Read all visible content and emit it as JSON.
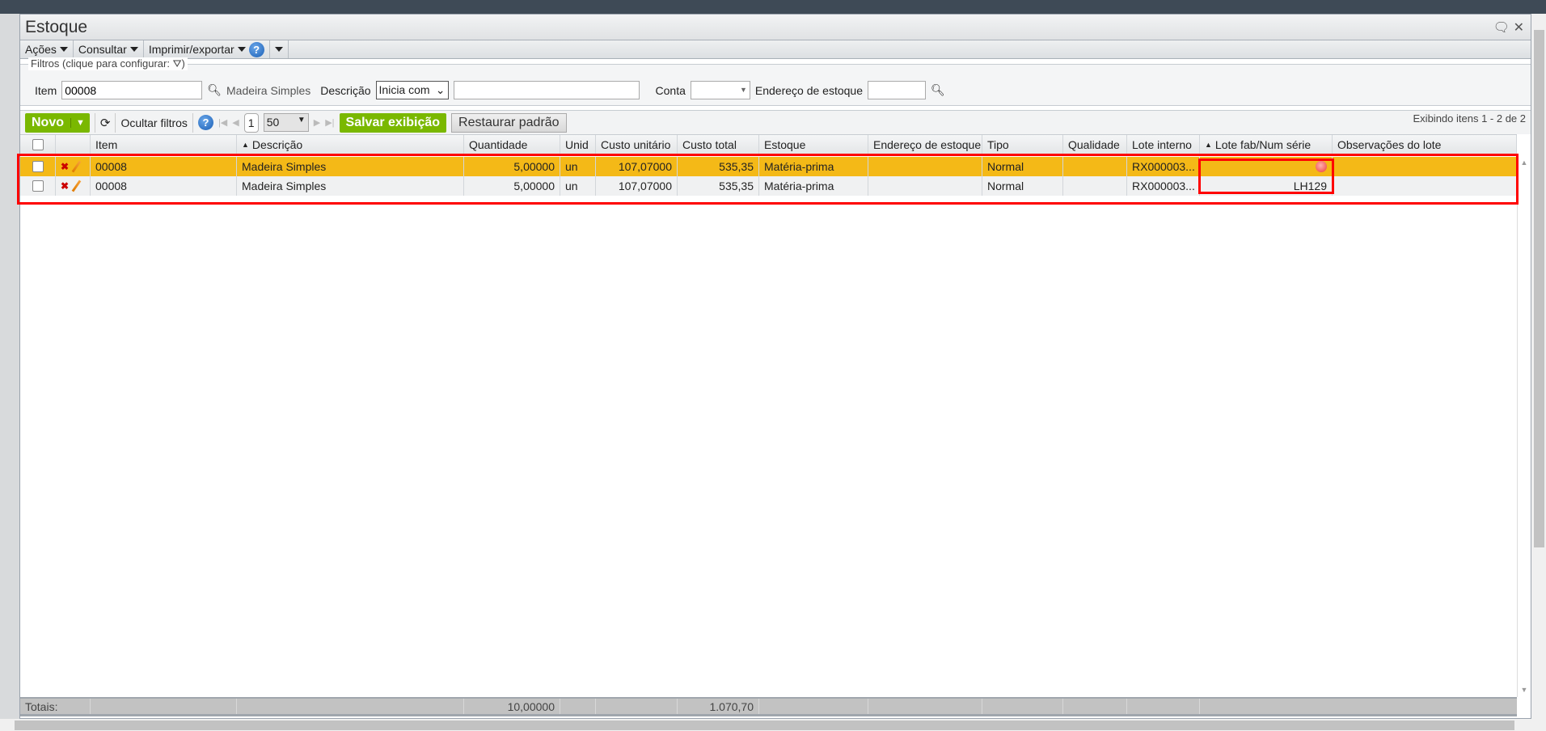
{
  "window": {
    "title": "Estoque"
  },
  "menu": [
    {
      "label": "Ações"
    },
    {
      "label": "Consultar"
    },
    {
      "label": "Imprimir/exportar"
    }
  ],
  "filters": {
    "legend": "Filtros (clique para configurar:",
    "legend_end": ")",
    "item_label": "Item",
    "item_value": "00008",
    "item_desc": "Madeira Simples",
    "descricao_label": "Descrição",
    "descricao_mode": "Inicia com",
    "descricao_value": "",
    "conta_label": "Conta",
    "conta_value": "",
    "endereco_label": "Endereço de estoque",
    "endereco_value": ""
  },
  "toolbar": {
    "novo": "Novo",
    "ocultar": "Ocultar filtros",
    "page": "1",
    "page_size": "50",
    "salvar": "Salvar exibição",
    "restaurar": "Restaurar padrão",
    "status": "Exibindo itens 1 - 2 de 2"
  },
  "columns": [
    "",
    "",
    "Item",
    "Descrição",
    "Quantidade",
    "Unid",
    "Custo unitário",
    "Custo total",
    "Estoque",
    "Endereço de estoque",
    "Tipo",
    "Qualidade",
    "Lote interno",
    "Lote fab/Num série",
    "Observações do lote"
  ],
  "rows": [
    {
      "item": "00008",
      "descricao": "Madeira Simples",
      "quantidade": "5,00000",
      "unid": "un",
      "custo_unit": "107,07000",
      "custo_total": "535,35",
      "estoque": "Matéria-prima",
      "endereco": "",
      "tipo": "Normal",
      "qualidade": "",
      "lote_interno": "RX000003...",
      "lote_fab": "",
      "obs": ""
    },
    {
      "item": "00008",
      "descricao": "Madeira Simples",
      "quantidade": "5,00000",
      "unid": "un",
      "custo_unit": "107,07000",
      "custo_total": "535,35",
      "estoque": "Matéria-prima",
      "endereco": "",
      "tipo": "Normal",
      "qualidade": "",
      "lote_interno": "RX000003...",
      "lote_fab": "LH129",
      "obs": ""
    }
  ],
  "totals": {
    "label": "Totais:",
    "quantidade": "10,00000",
    "custo_total": "1.070,70"
  },
  "colors": {
    "selected_row": "#f4b917",
    "accent": "#7ab800",
    "highlight": "#ff0000"
  }
}
